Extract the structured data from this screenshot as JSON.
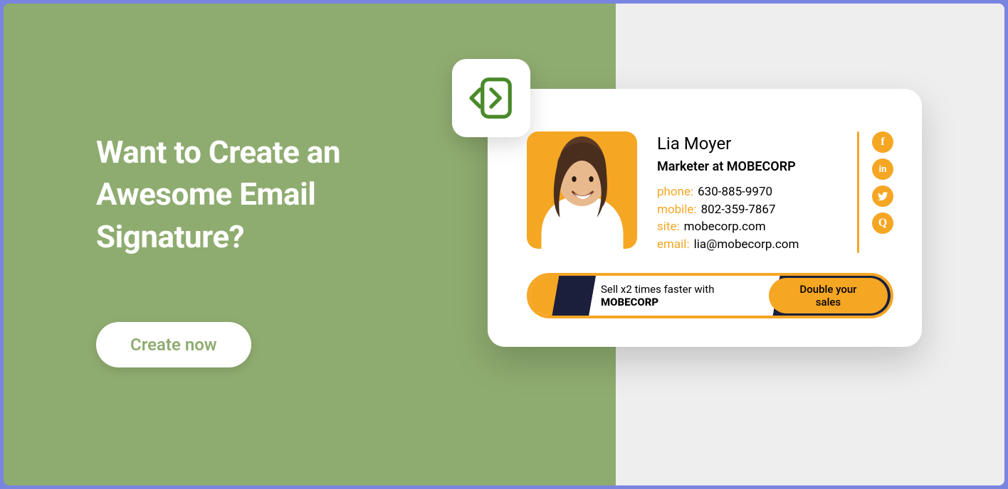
{
  "promo": {
    "headline": "Want to Create an Awesome Email Signature?",
    "cta_label": "Create now"
  },
  "signature": {
    "name": "Lia Moyer",
    "job_title": "Marketer at MOBECORP",
    "contacts": {
      "phone_label": "phone:",
      "phone_value": "630-885-9970",
      "mobile_label": "mobile:",
      "mobile_value": "802-359-7867",
      "site_label": "site:",
      "site_value": "mobecorp.com",
      "email_label": "email:",
      "email_value": "lia@mobecorp.com"
    },
    "socials": [
      "f",
      "in",
      "tw",
      "Q"
    ]
  },
  "banner": {
    "text_prefix": "Sell x2 times faster with ",
    "text_brand": "MOBECORP",
    "button_label": "Double your sales"
  },
  "colors": {
    "accent": "#f5a623",
    "green": "#8fac70"
  }
}
